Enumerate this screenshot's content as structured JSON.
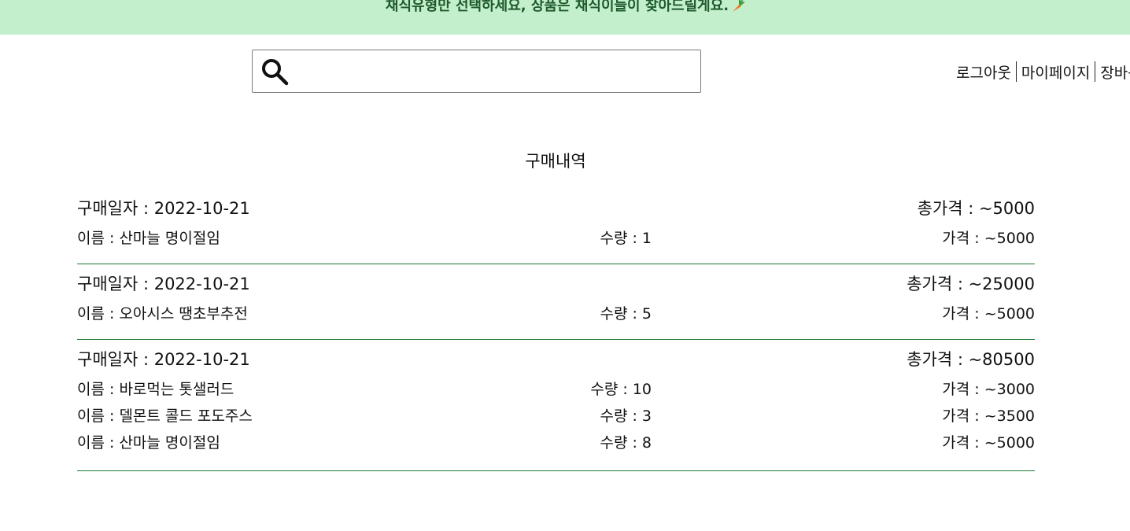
{
  "banner": {
    "text": "채식유형만 선택하세요, 상품은 채식이들이 찾아드릴게요.",
    "accent_bg": "#c3efcc",
    "accent_text": "#1f5a2c"
  },
  "search": {
    "icon": "search-icon",
    "value": "",
    "placeholder": ""
  },
  "nav": {
    "logout": "로그아웃",
    "mypage": "마이페이지",
    "cart": "장바구니"
  },
  "page": {
    "title": "구매내역"
  },
  "orders": [
    {
      "date": "구매일자 : 2022-10-21",
      "total": "총가격 : ~5000",
      "items": [
        {
          "name": "이름 : 산마늘 명이절임",
          "qty": "수량 : 1",
          "price": "가격 : ~5000"
        }
      ]
    },
    {
      "date": "구매일자 : 2022-10-21",
      "total": "총가격 : ~25000",
      "items": [
        {
          "name": "이름 : 오아시스 땡초부추전",
          "qty": "수량 : 5",
          "price": "가격 : ~5000"
        }
      ]
    },
    {
      "date": "구매일자 : 2022-10-21",
      "total": "총가격 : ~80500",
      "items": [
        {
          "name": "이름 : 바로먹는 톳샐러드",
          "qty": "수량 : 10",
          "price": "가격 : ~3000"
        },
        {
          "name": "이름 : 델몬트 콜드 포도주스",
          "qty": "수량 : 3",
          "price": "가격 : ~3500"
        },
        {
          "name": "이름 : 산마늘 명이절임",
          "qty": "수량 : 8",
          "price": "가격 : ~5000"
        }
      ]
    }
  ],
  "colors": {
    "divider": "#1e7a33"
  }
}
